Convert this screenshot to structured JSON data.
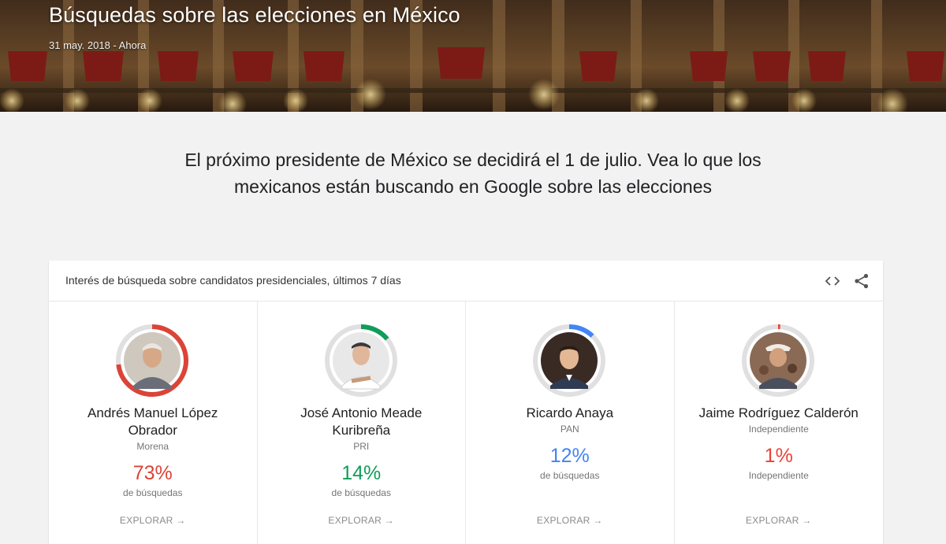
{
  "header": {
    "title": "Búsquedas sobre las elecciones en México",
    "date_range": "31 may. 2018 - Ahora"
  },
  "intro": "El próximo presidente de México se decidirá el 1 de julio. Vea lo que los mexicanos están buscando en Google sobre las elecciones",
  "card": {
    "title": "Interés de búsqueda sobre candidatos presidenciales, últimos 7 días",
    "embed_icon": "embed-code-icon",
    "share_icon": "share-icon"
  },
  "candidates": [
    {
      "name_line1": "Andrés Manuel López",
      "name_line2": "Obrador",
      "party": "Morena",
      "percent": "73%",
      "share": 0.73,
      "color": "#db4437",
      "label": "de búsquedas",
      "explore": "EXPLORAR"
    },
    {
      "name_line1": "José Antonio Meade",
      "name_line2": "Kuribreña",
      "party": "PRI",
      "percent": "14%",
      "share": 0.14,
      "color": "#0f9d58",
      "label": "de búsquedas",
      "explore": "EXPLORAR"
    },
    {
      "name_line1": "Ricardo Anaya",
      "name_line2": "",
      "party": "PAN",
      "percent": "12%",
      "share": 0.12,
      "color": "#4285f4",
      "label": "de búsquedas",
      "explore": "EXPLORAR"
    },
    {
      "name_line1": "Jaime Rodríguez Calderón",
      "name_line2": "",
      "party": "Independiente",
      "percent": "1%",
      "share": 0.01,
      "color": "#ea4335",
      "label": "Independiente",
      "explore": "EXPLORAR"
    }
  ]
}
